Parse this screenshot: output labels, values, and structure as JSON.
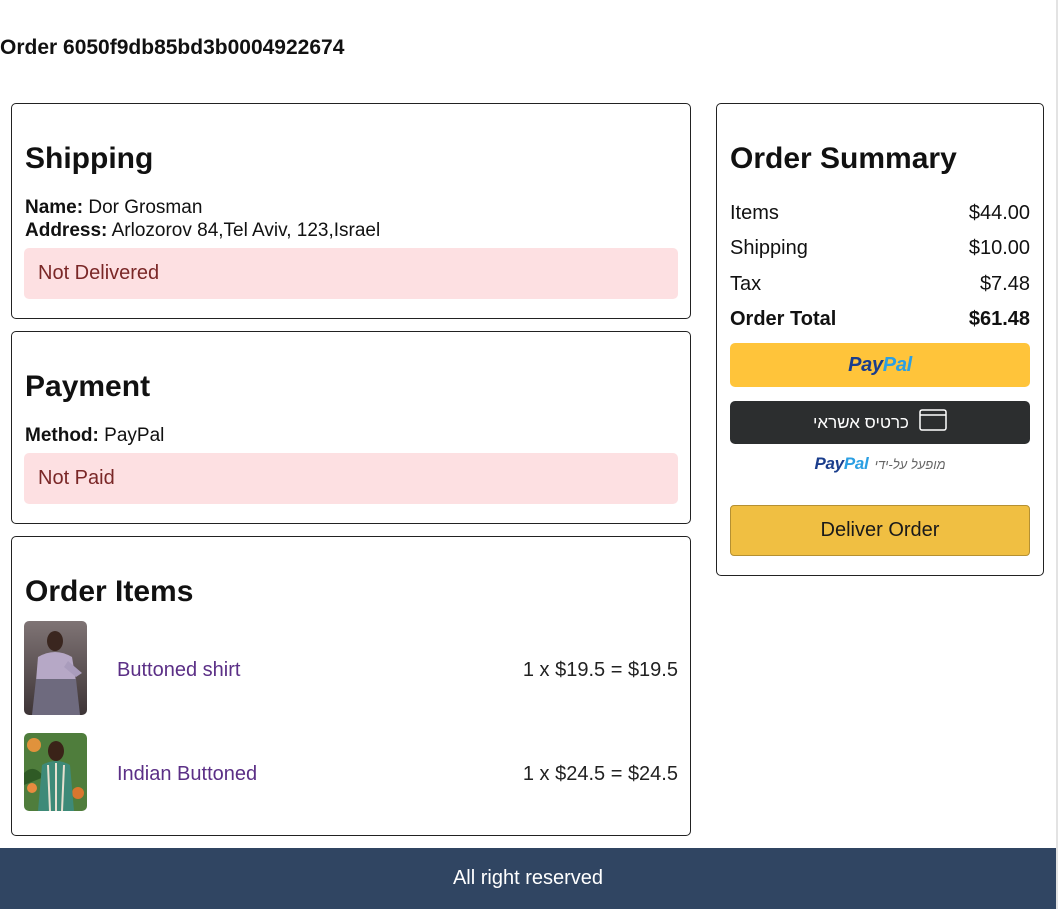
{
  "order": {
    "title": "Order 6050f9db85bd3b0004922674"
  },
  "shipping": {
    "heading": "Shipping",
    "name_label": "Name:",
    "name_value": "Dor Grosman",
    "address_label": "Address:",
    "address_value": "Arlozorov 84,Tel Aviv, 123,Israel",
    "status": "Not Delivered"
  },
  "payment": {
    "heading": "Payment",
    "method_label": "Method:",
    "method_value": "PayPal",
    "status": "Not Paid"
  },
  "items": {
    "heading": "Order Items",
    "list": [
      {
        "name": "Buttoned shirt",
        "calc": "1 x $19.5 = $19.5",
        "image": "man-in-purple-shirt-photo"
      },
      {
        "name": "Indian Buttoned",
        "calc": "1 x $24.5 = $24.5",
        "image": "man-in-striped-shirt-photo"
      }
    ]
  },
  "summary": {
    "heading": "Order Summary",
    "rows": [
      {
        "label": "Items",
        "value": "$44.00"
      },
      {
        "label": "Shipping",
        "value": "$10.00"
      },
      {
        "label": "Tax",
        "value": "$7.48"
      },
      {
        "label": "Order Total",
        "value": "$61.48"
      }
    ],
    "paypal_button": {
      "logo_part1": "Pay",
      "logo_part2": "Pal"
    },
    "card_button": {
      "label": "כרטיס אשראי",
      "icon": "credit-card-icon"
    },
    "powered_by": {
      "text": "מופעל על-ידי",
      "logo_part1": "Pay",
      "logo_part2": "Pal"
    },
    "deliver_button": "Deliver Order"
  },
  "footer": {
    "text": "All right reserved"
  },
  "colors": {
    "alert_bg": "#fde0e2",
    "alert_text": "#7a2727",
    "paypal_yellow": "#ffc43a",
    "card_dark": "#2c2e2f",
    "deliver_yellow": "#f0bf42",
    "link_purple": "#5b2f86",
    "footer_bg": "#304562"
  }
}
